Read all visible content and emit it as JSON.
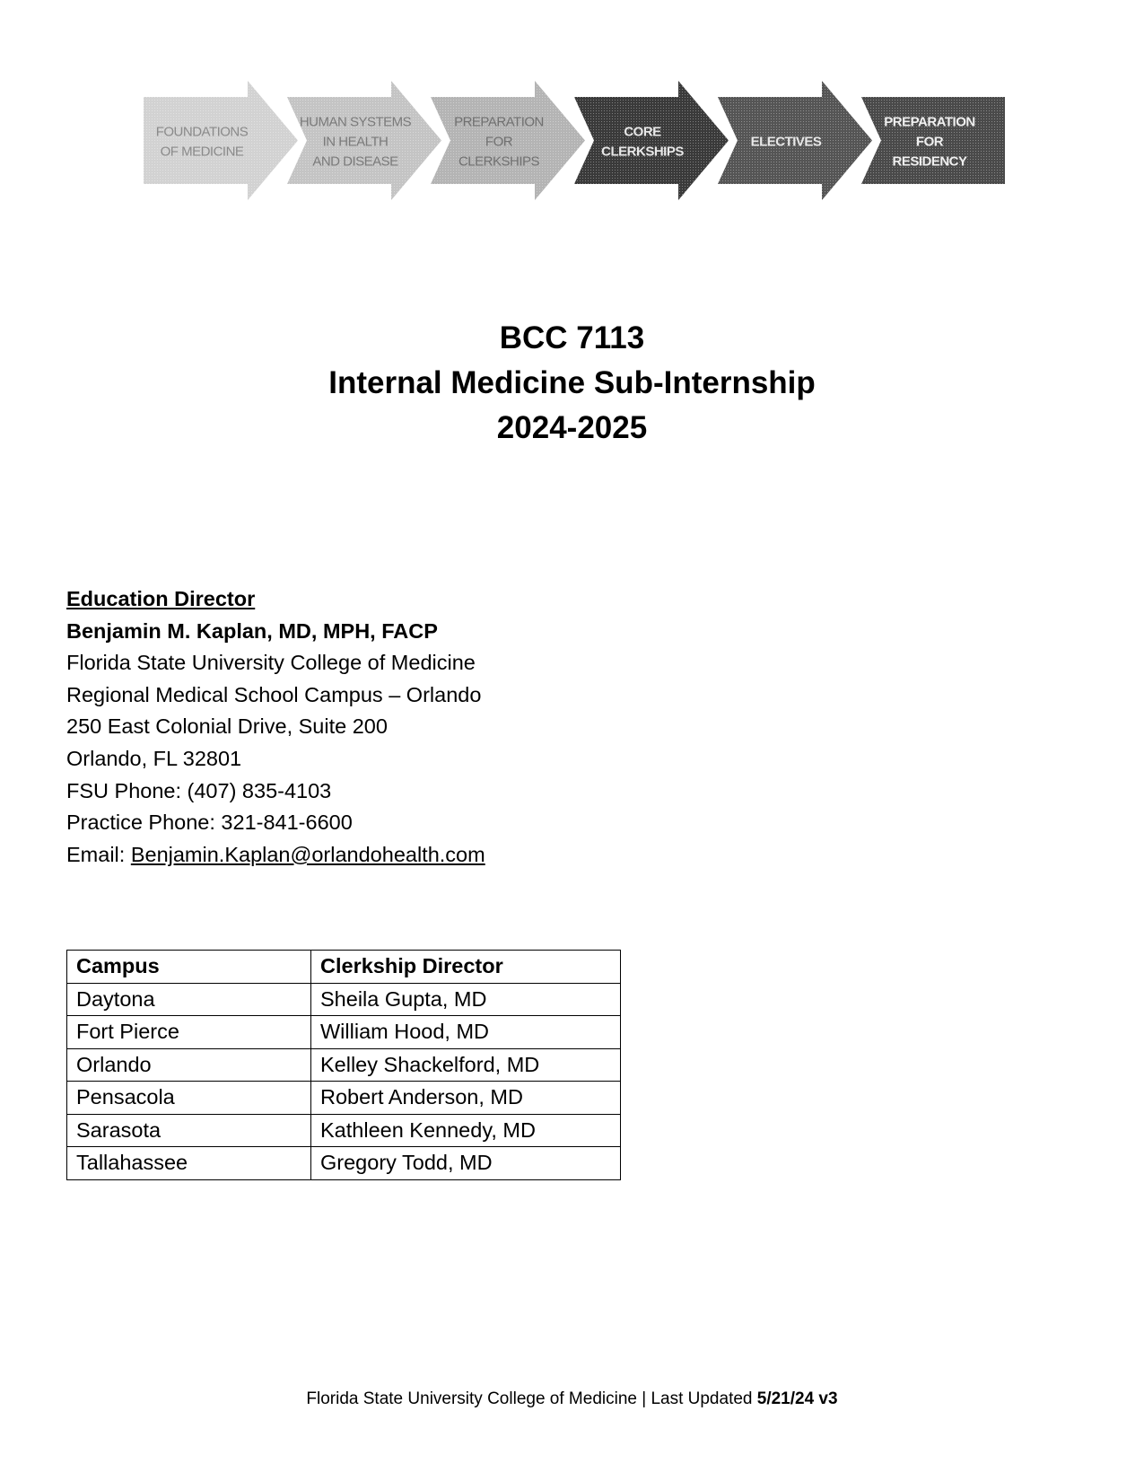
{
  "banner": {
    "stages": [
      {
        "lines": [
          "FOUNDATIONS",
          "OF MEDICINE"
        ],
        "fill": "#d2d2d2",
        "text_color": "#8a8a8a"
      },
      {
        "lines": [
          "HUMAN SYSTEMS",
          "IN HEALTH",
          "AND DISEASE"
        ],
        "fill": "#c4c4c4",
        "text_color": "#7a7a7a"
      },
      {
        "lines": [
          "PREPARATION",
          "FOR",
          "CLERKSHIPS"
        ],
        "fill": "#b4b4b4",
        "text_color": "#707070"
      },
      {
        "lines": [
          "CORE",
          "CLERKSHIPS"
        ],
        "fill": "#3a3a3a",
        "text_color": "#e8e8e8"
      },
      {
        "lines": [
          "ELECTIVES"
        ],
        "fill": "#555555",
        "text_color": "#e8e8e8"
      },
      {
        "lines": [
          "PREPARATION",
          "FOR",
          "RESIDENCY"
        ],
        "fill": "#4a4a4a",
        "text_color": "#f0f0f0"
      }
    ]
  },
  "title": {
    "course_code": "BCC 7113",
    "course_name": "Internal Medicine Sub-Internship",
    "academic_year": "2024-2025"
  },
  "education_director": {
    "heading": "Education Director",
    "name_bold": "Benjamin M. Kaplan, MD",
    "credentials": ", MPH, FACP",
    "lines": [
      "Florida State University College of Medicine",
      "Regional Medical School Campus – Orlando",
      "250 East Colonial Drive, Suite 200",
      "Orlando, FL 32801",
      "FSU Phone: (407) 835-4103",
      "Practice Phone: 321-841-6600"
    ],
    "email_label": "Email: ",
    "email": "Benjamin.Kaplan@orlandohealth.com"
  },
  "directors_table": {
    "headers": [
      "Campus",
      "Clerkship Director"
    ],
    "rows": [
      [
        "Daytona",
        "Sheila Gupta, MD"
      ],
      [
        "Fort Pierce",
        "William Hood, MD"
      ],
      [
        "Orlando",
        "Kelley Shackelford, MD"
      ],
      [
        "Pensacola",
        "Robert Anderson, MD"
      ],
      [
        "Sarasota",
        "Kathleen Kennedy, MD"
      ],
      [
        "Tallahassee",
        "Gregory Todd, MD"
      ]
    ]
  },
  "footer": {
    "text": "Florida State University College of Medicine | Last Updated ",
    "version_bold": "5/21/24 v3"
  }
}
